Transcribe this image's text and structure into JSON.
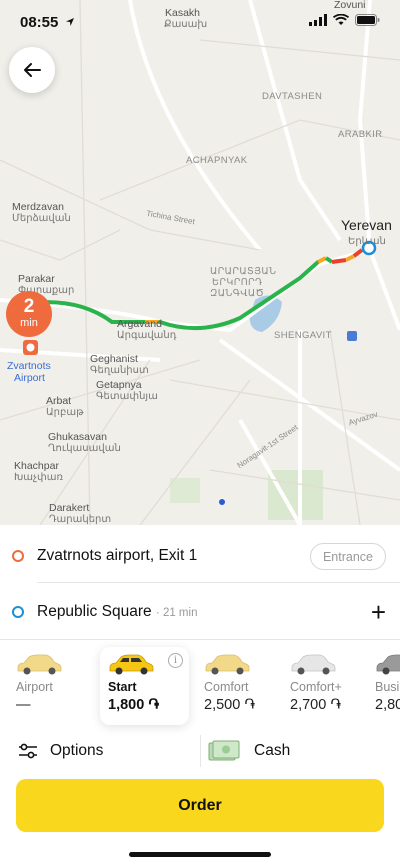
{
  "status": {
    "time": "08:55"
  },
  "map": {
    "labels": {
      "kasakh": "Kasakh",
      "kasakh_am": "Քասախ",
      "zovuni": "Zovuni",
      "zovuni_am": "Զովունի",
      "davtashen": "DAVTASHEN",
      "arabkir": "ARABKIR",
      "achapnyak": "ACHAPNYAK",
      "merdzavan": "Merdzavan",
      "merdzavan_am": "Մերձավան",
      "yerevan": "Yerevan",
      "yerevan_am": "Երևան",
      "parakar": "Parakar",
      "parakar_am": "Փարաքար",
      "arar1": "ԱՐԱՐԱՏՅԱՆ",
      "arar2": "ԵՐԿՐՈՐԴ",
      "arar3": "ԶԱՆԳՎԱԾ",
      "argavand": "Argavand",
      "argavand_am": "Արգավանդ",
      "shengavit": "SHENGAVIT",
      "zvartnots1": "Zvartnots",
      "zvartnots2": "Airport",
      "geghanist": "Geghanist",
      "geghanist_am": "Գեղանիստ",
      "getapnya": "Getapnya",
      "getapnya_am": "Գետափնյա",
      "arbat": "Arbat",
      "arbat_am": "Արբաթ",
      "ghukasavan": "Ghukasavan",
      "ghukasavan_am": "Ղուկասավան",
      "khachpar": "Khachpar",
      "khachpar_am": "Խաչփառ",
      "darakert": "Darakert",
      "darakert_am": "Դարակերտ",
      "tichina": "Tichina Street",
      "noragavit": "Noragavit-1st Street",
      "ayvazov": "Ayvazov"
    },
    "eta": {
      "value": "2",
      "unit": "min"
    },
    "colors": {
      "route_free": "#2bb34b",
      "route_slow": "#f5a623",
      "route_jam": "#e8412c",
      "origin": "#ef6b3d",
      "destination": "#1a8fd6"
    }
  },
  "route": {
    "from": {
      "address": "Zvatrnots airport, Exit 1",
      "entrance_label": "Entrance"
    },
    "to": {
      "address": "Republic Square",
      "duration": "· 21 min",
      "add_label": "+"
    }
  },
  "tariffs": [
    {
      "name": "Airport",
      "price": "—",
      "car_color": "#f2d98a"
    },
    {
      "name": "Start",
      "price": "1,800 ֏",
      "car_color": "#f5c614",
      "selected": true
    },
    {
      "name": "Comfort",
      "price": "2,500 ֏",
      "car_color": "#f2d98a"
    },
    {
      "name": "Comfort+",
      "price": "2,700 ֏",
      "car_color": "#e6e6e6"
    },
    {
      "name": "Busi",
      "price": "2,80",
      "car_color": "#9a9a9a"
    }
  ],
  "options": {
    "options_label": "Options",
    "payment_label": "Cash"
  },
  "order": {
    "label": "Order"
  },
  "accent": "#f9d71c"
}
